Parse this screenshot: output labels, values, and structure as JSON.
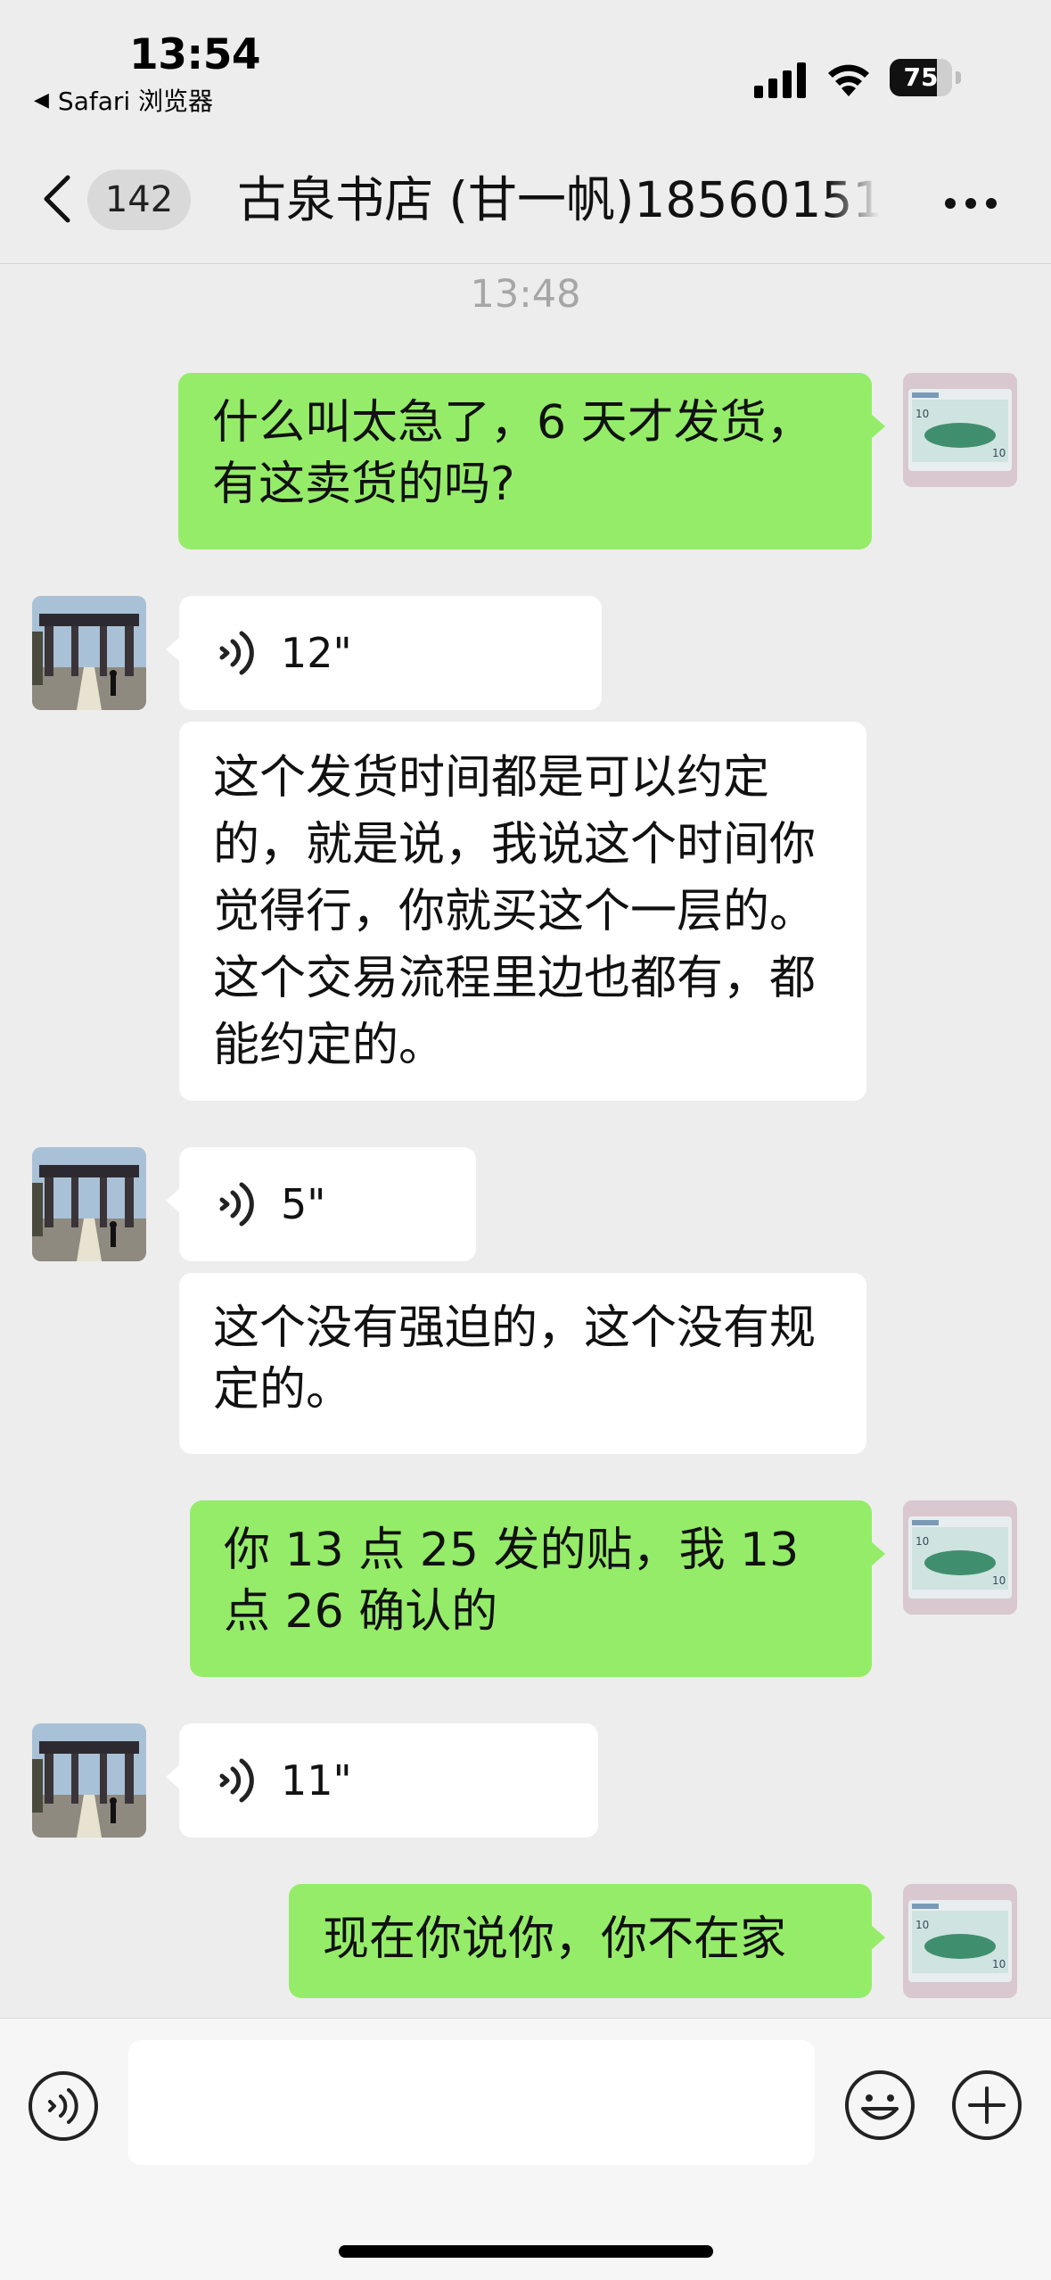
{
  "status_bar": {
    "time": "13:54",
    "back_app_label": "Safari 浏览器",
    "battery_level": "75",
    "battery_fraction": 0.75
  },
  "nav": {
    "unread_count": "142",
    "title": "古泉书店 (甘一帆)18560151"
  },
  "chat": {
    "timestamp": "13:48",
    "messages": [
      {
        "sender": "me",
        "type": "text",
        "text": "什么叫太急了，6 天才发货，有这卖货的吗?"
      },
      {
        "sender": "other",
        "type": "voice",
        "duration": "12\""
      },
      {
        "sender": "other",
        "type": "text",
        "text": "这个发货时间都是可以约定的，就是说，我说这个时间你觉得行，你就买这个一层的。这个交易流程里边也都有，都能约定的。"
      },
      {
        "sender": "other",
        "type": "voice",
        "duration": "5\""
      },
      {
        "sender": "other",
        "type": "text",
        "text": "这个没有强迫的，这个没有规定的。"
      },
      {
        "sender": "me",
        "type": "text",
        "text": "你 13 点 25 发的贴，我 13 点 26 确认的"
      },
      {
        "sender": "other",
        "type": "voice",
        "duration": "11\""
      },
      {
        "sender": "me",
        "type": "text",
        "text": "现在你说你，你不在家"
      }
    ]
  },
  "input_bar": {
    "placeholder": ""
  },
  "icons": {
    "voice_toggle": "voice-input-icon",
    "emoji": "emoji-icon",
    "plus": "plus-icon",
    "more": "more-icon",
    "back": "chevron-left-icon"
  },
  "colors": {
    "my_bubble": "#95ec69",
    "other_bubble": "#ffffff",
    "background": "#ededed"
  }
}
